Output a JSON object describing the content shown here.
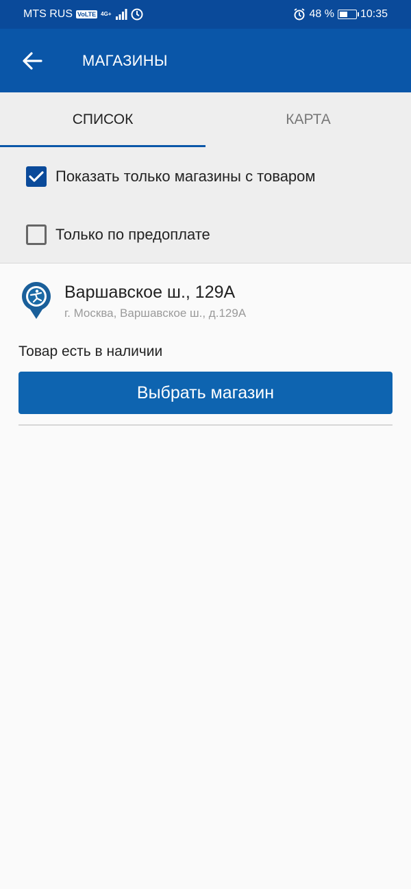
{
  "status_bar": {
    "carrier": "MTS RUS",
    "volte": "VoLTE",
    "network": "4G+",
    "battery": "48 %",
    "battery_level": 0.48,
    "time": "10:35"
  },
  "app_bar": {
    "title": "МАГАЗИНЫ"
  },
  "tabs": [
    {
      "label": "СПИСОК",
      "active": true
    },
    {
      "label": "КАРТА",
      "active": false
    }
  ],
  "filters": [
    {
      "label": "Показать только магазины с товаром",
      "checked": true
    },
    {
      "label": "Только по предоплате",
      "checked": false
    }
  ],
  "store": {
    "name": "Варшавское ш., 129А",
    "address": "г. Москва, Варшавское ш., д.129А",
    "availability": "Товар есть в наличии",
    "select_label": "Выбрать магазин"
  },
  "colors": {
    "primary": "#0a56a8",
    "status_bar": "#0a4a9a",
    "button": "#0e64b0"
  }
}
